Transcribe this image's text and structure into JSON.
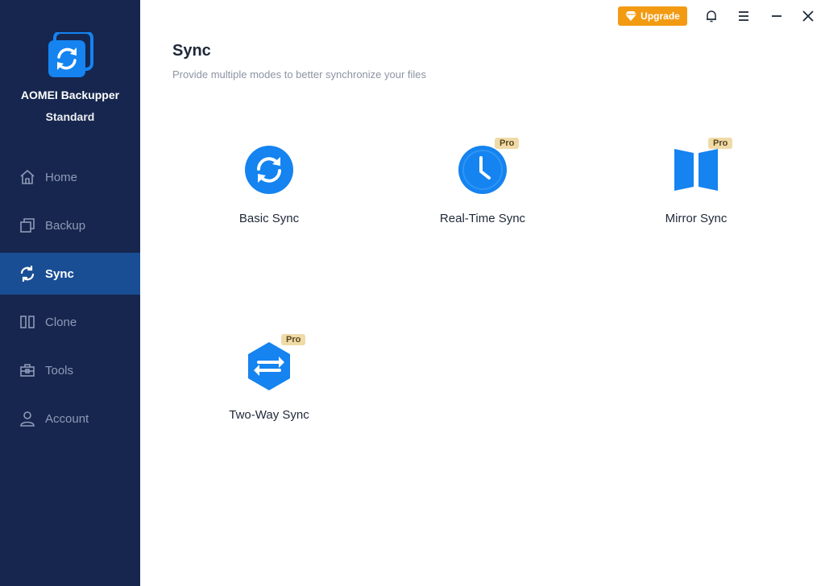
{
  "app": {
    "name": "AOMEI Backupper",
    "edition": "Standard"
  },
  "titlebar": {
    "upgrade_label": "Upgrade"
  },
  "nav": [
    {
      "label": "Home",
      "icon": "home-icon"
    },
    {
      "label": "Backup",
      "icon": "backup-icon"
    },
    {
      "label": "Sync",
      "icon": "sync-icon",
      "active": true
    },
    {
      "label": "Clone",
      "icon": "clone-icon"
    },
    {
      "label": "Tools",
      "icon": "tools-icon"
    },
    {
      "label": "Account",
      "icon": "account-icon"
    }
  ],
  "main": {
    "title": "Sync",
    "subtitle": "Provide multiple modes to better synchronize your files",
    "options": [
      {
        "label": "Basic Sync",
        "icon": "basic-sync-icon"
      },
      {
        "label": "Real-Time Sync",
        "icon": "real-time-sync-icon",
        "badge": "Pro"
      },
      {
        "label": "Mirror Sync",
        "icon": "mirror-sync-icon",
        "badge": "Pro"
      },
      {
        "label": "Two-Way Sync",
        "icon": "two-way-sync-icon",
        "badge": "Pro"
      }
    ]
  },
  "colors": {
    "sidebar": "#16264e",
    "active": "#1a4e94",
    "accent": "#1583f0",
    "upgrade": "#f29b12",
    "pro_badge": "#f0dba8"
  }
}
